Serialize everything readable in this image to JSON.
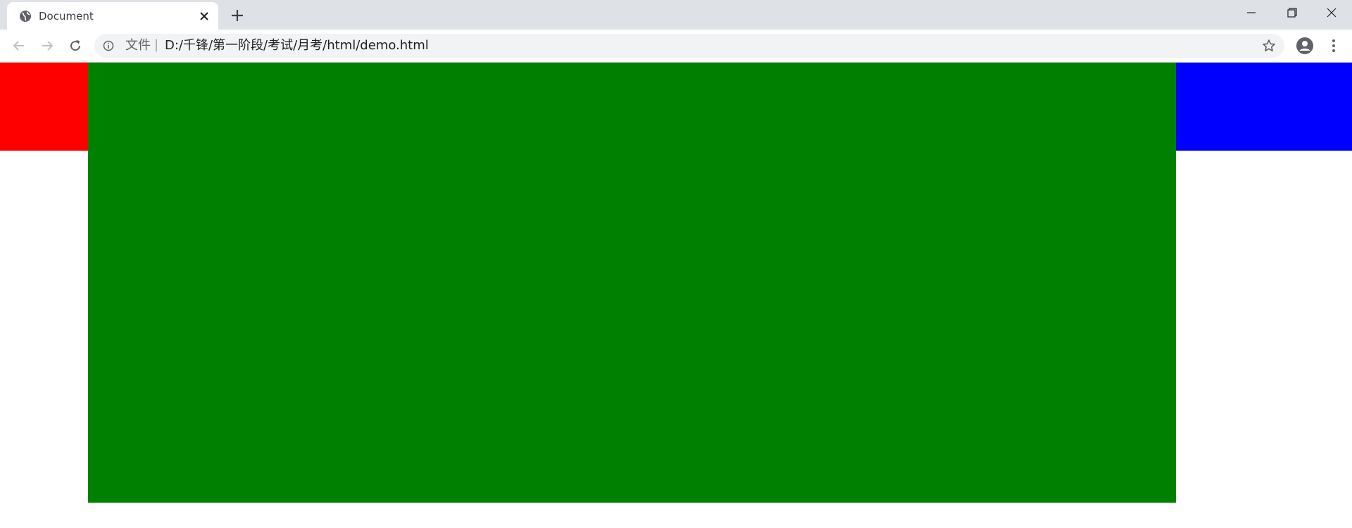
{
  "tab": {
    "title": "Document",
    "favicon_icon": "globe-icon",
    "close_icon": "close-icon"
  },
  "new_tab_icon": "plus-icon",
  "window_controls": {
    "minimize_icon": "minimize-icon",
    "restore_icon": "restore-icon",
    "close_icon": "window-close-icon"
  },
  "toolbar": {
    "back_icon": "arrow-left-icon",
    "forward_icon": "arrow-right-icon",
    "reload_icon": "reload-icon"
  },
  "omnibox": {
    "info_icon": "info-icon",
    "scheme_label": "文件",
    "separator": "|",
    "url": "D:/千锋/第一阶段/考试/月考/html/demo.html",
    "bookmark_icon": "star-icon"
  },
  "profile_icon": "account-circle-icon",
  "menu_icon": "more-vert-icon",
  "page": {
    "boxes": [
      {
        "name": "left",
        "color": "#ff0000"
      },
      {
        "name": "center",
        "color": "#008000"
      },
      {
        "name": "right",
        "color": "#0000ff"
      }
    ]
  },
  "colors": {
    "tabstrip": "#dee1e6",
    "omnibox": "#f1f3f4",
    "red": "#ff0000",
    "green": "#008000",
    "blue": "#0000ff"
  }
}
